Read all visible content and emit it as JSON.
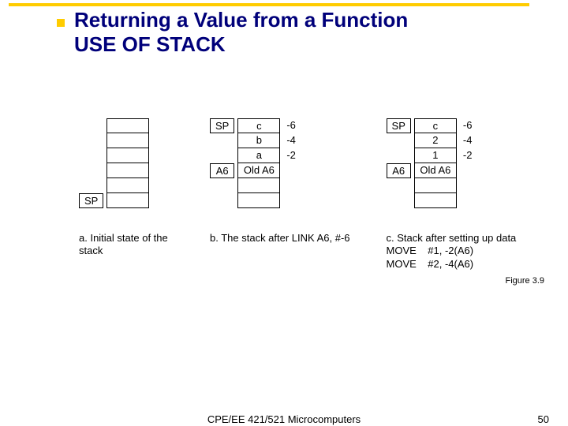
{
  "title_line1": "Returning a Value from a Function",
  "title_line2": "USE OF STACK",
  "diagrams": {
    "a": {
      "sp_label": "SP",
      "caption": "a. Initial state of the stack"
    },
    "b": {
      "sp_label": "SP",
      "a6_label": "A6",
      "cells": {
        "c": "c",
        "b": "b",
        "a": "a",
        "old_a6": "Old A6"
      },
      "offsets": {
        "c": "-6",
        "b": "-4",
        "a": "-2"
      },
      "caption": "b. The stack after LINK A6, #-6"
    },
    "c": {
      "sp_label": "SP",
      "a6_label": "A6",
      "cells": {
        "c": "c",
        "v2": "2",
        "v1": "1",
        "old_a6": "Old A6"
      },
      "offsets": {
        "c": "-6",
        "v2": "-4",
        "v1": "-2"
      },
      "caption_line1": "c. Stack after setting up data",
      "caption_line2": "MOVE    #1, -2(A6)",
      "caption_line3": "MOVE    #2, -4(A6)"
    }
  },
  "figure_label": "Figure 3.9",
  "footer_center": "CPE/EE 421/521 Microcomputers",
  "page_number": "50"
}
